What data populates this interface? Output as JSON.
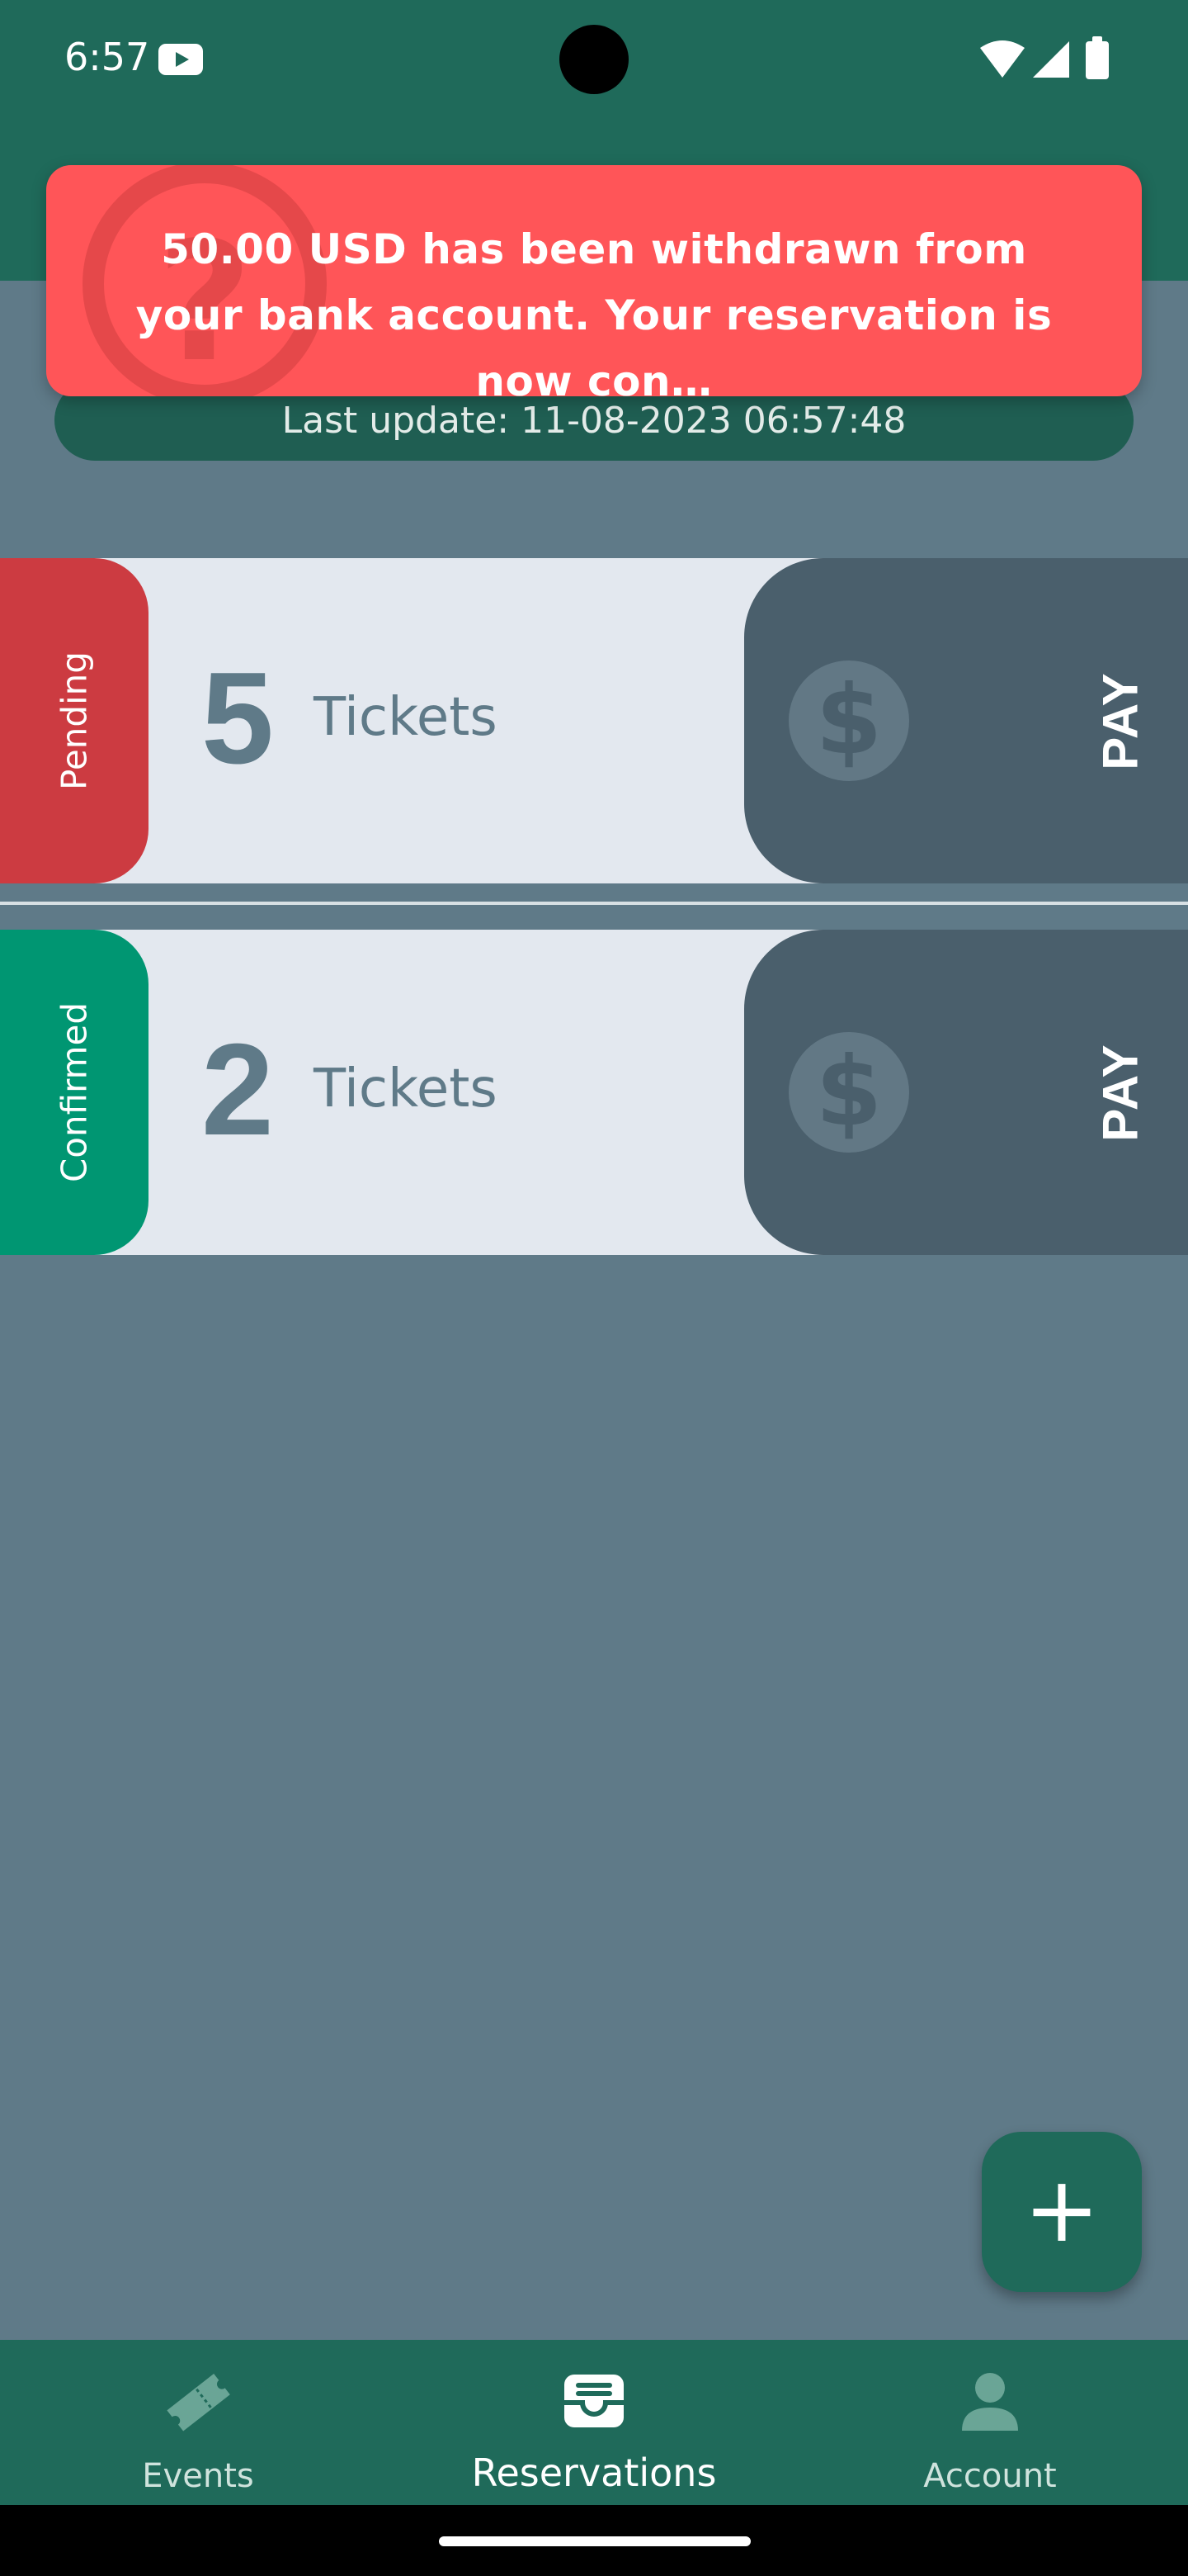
{
  "status_bar": {
    "time": "6:57"
  },
  "toast": {
    "message": "50.00 USD has been withdrawn from your bank account. Your reservation is now con…",
    "background_icon": "question-mark-icon"
  },
  "header": {
    "last_update": "Last update: 11-08-2023  06:57:48"
  },
  "reservations": [
    {
      "status": "Pending",
      "status_color": "#cc3b41",
      "count": "5",
      "unit": "Tickets",
      "action": "PAY",
      "action_icon": "dollar-icon"
    },
    {
      "status": "Confirmed",
      "status_color": "#009672",
      "count": "2",
      "unit": "Tickets",
      "action": "PAY",
      "action_icon": "dollar-icon"
    }
  ],
  "fab": {
    "label": "+"
  },
  "bottom_nav": {
    "items": [
      {
        "label": "Events",
        "icon": "ticket-icon",
        "active": false
      },
      {
        "label": "Reservations",
        "icon": "inbox-icon",
        "active": true
      },
      {
        "label": "Account",
        "icon": "person-icon",
        "active": false
      }
    ]
  },
  "colors": {
    "primary": "#1f6a5a",
    "background": "#5f7a88",
    "toast": "#ff5558",
    "pay_block": "#4a5f6c"
  }
}
